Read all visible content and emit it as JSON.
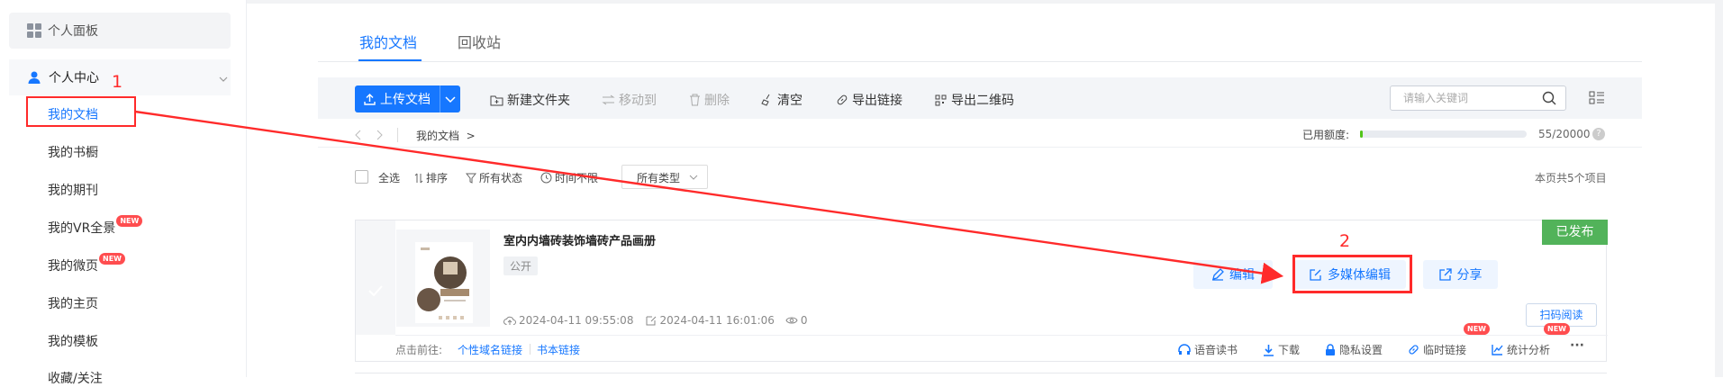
{
  "sidebar": {
    "panel_label": "个人面板",
    "section_label": "个人中心",
    "items": [
      {
        "label": "我的文档",
        "active": true,
        "new": false
      },
      {
        "label": "我的书橱",
        "new": false
      },
      {
        "label": "我的期刊",
        "new": false
      },
      {
        "label": "我的VR全景",
        "new": true
      },
      {
        "label": "我的微页",
        "new": true
      },
      {
        "label": "我的主页",
        "new": false
      },
      {
        "label": "我的模板",
        "new": false
      },
      {
        "label": "收藏/关注",
        "new": false
      }
    ],
    "new_badge": "NEW"
  },
  "tabs": [
    {
      "label": "我的文档",
      "active": true
    },
    {
      "label": "回收站",
      "active": false
    }
  ],
  "toolbar": {
    "upload": "上传文档",
    "new_folder": "新建文件夹",
    "move_to": "移动到",
    "delete": "删除",
    "clear": "清空",
    "export_link": "导出链接",
    "export_qr": "导出二维码",
    "search_placeholder": "请输入关键词"
  },
  "breadcrumb": {
    "path": "我的文档",
    "sep": ">"
  },
  "quota": {
    "label": "已用额度:",
    "value": "55/20000",
    "fraction": 0.00275
  },
  "filters": {
    "select_all": "全选",
    "sort": "排序",
    "status": "所有状态",
    "time": "时间不限",
    "type": "所有类型",
    "count": "本页共5个项目"
  },
  "document": {
    "title": "室内内墙砖装饰墙砖产品画册",
    "visibility": "公开",
    "status_badge": "已发布",
    "created": "2024-04-11 09:55:08",
    "modified": "2024-04-11 16:01:06",
    "views": "0",
    "edit": "编辑",
    "media_edit": "多媒体编辑",
    "share": "分享",
    "scan_read": "扫码阅读",
    "goto_label": "点击前往:",
    "link1": "个性域名链接",
    "link2": "书本链接",
    "footer_actions": {
      "voice": "语音读书",
      "download": "下载",
      "privacy": "隐私设置",
      "temp_link": "临时链接",
      "stats": "统计分析",
      "more": "···"
    }
  },
  "annotations": {
    "step1": "1",
    "step2": "2"
  },
  "colors": {
    "primary": "#1677ff",
    "annotation": "#ff2a2a",
    "published": "#52b35a"
  }
}
